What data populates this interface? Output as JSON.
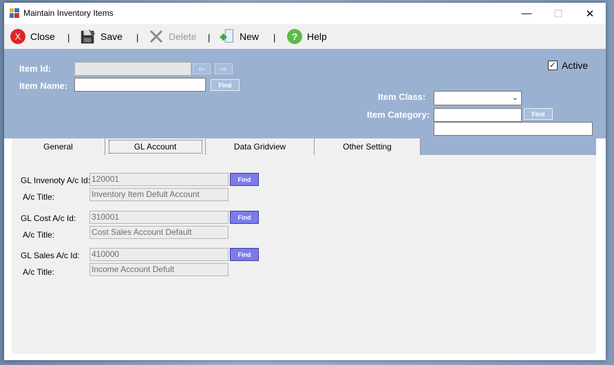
{
  "window": {
    "title": "Maintain Inventory Items",
    "controls": {
      "minimize": "—",
      "maximize": "☐",
      "close": "✕"
    }
  },
  "toolbar": {
    "close_label": "Close",
    "save_label": "Save",
    "delete_label": "Delete",
    "new_label": "New",
    "help_label": "Help",
    "separator": "|"
  },
  "header": {
    "item_id_label": "Item Id:",
    "item_id_value": "",
    "item_name_label": "Item Name:",
    "item_name_value": "",
    "find_label": "Find",
    "active_label": "Active",
    "active_checked": true,
    "item_class_label": "Item Class:",
    "item_class_value": "",
    "item_category_label": "Item Category:",
    "item_category_value": "",
    "item_category_desc": ""
  },
  "tabs": [
    {
      "label": "General"
    },
    {
      "label": "GL Account",
      "active": true
    },
    {
      "label": "Data Gridview"
    },
    {
      "label": "Other Setting"
    }
  ],
  "gl": {
    "inventory_label": "GL Invenoty A/c Id:",
    "inventory_id": "120001",
    "inventory_title_label": "A/c Title:",
    "inventory_title": "Inventory Item Defult Account",
    "cost_label": "GL Cost A/c Id:",
    "cost_id": "310001",
    "cost_title_label": "A/c Title:",
    "cost_title": "Cost Sales Account Default",
    "sales_label": "GL Sales A/c Id:",
    "sales_id": "410000",
    "sales_title_label": "A/c Title:",
    "sales_title": "Income Account Defult",
    "find_label": "Find"
  },
  "colors": {
    "header_bg": "#9ab1d1",
    "find_button": "#7b7bea",
    "close_icon": "#e02424",
    "help_icon": "#5fb84a"
  }
}
